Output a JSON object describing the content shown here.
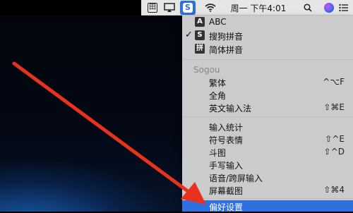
{
  "menubar": {
    "input_badge": "田",
    "sogou_badge": "S",
    "clock": "周一 下午4:01"
  },
  "menu": {
    "sources": [
      {
        "icon": "A",
        "label": "ABC",
        "checked": false
      },
      {
        "icon": "S",
        "label": "搜狗拼音",
        "checked": true
      },
      {
        "icon": "拼",
        "label": "简体拼音",
        "checked": false
      }
    ],
    "check_mark": "✓",
    "section_title": "Sogou",
    "group1": [
      {
        "label": "繁体",
        "shortcut": "^⌥F"
      },
      {
        "label": "全角",
        "shortcut": ""
      },
      {
        "label": "英文输入法",
        "shortcut": "⇧⌘E"
      }
    ],
    "group2": [
      {
        "label": "输入统计",
        "shortcut": ""
      },
      {
        "label": "符号表情",
        "shortcut": "⇧^E"
      },
      {
        "label": "斗图",
        "shortcut": "⇧^D"
      },
      {
        "label": "手写输入",
        "shortcut": ""
      },
      {
        "label": "语音/跨屏输入",
        "shortcut": ""
      },
      {
        "label": "屏幕截图",
        "shortcut": "⇧⌘4"
      }
    ],
    "preferences": "偏好设置"
  },
  "colors": {
    "highlight": "#2f6fe0",
    "arrow": "#e8321e"
  }
}
